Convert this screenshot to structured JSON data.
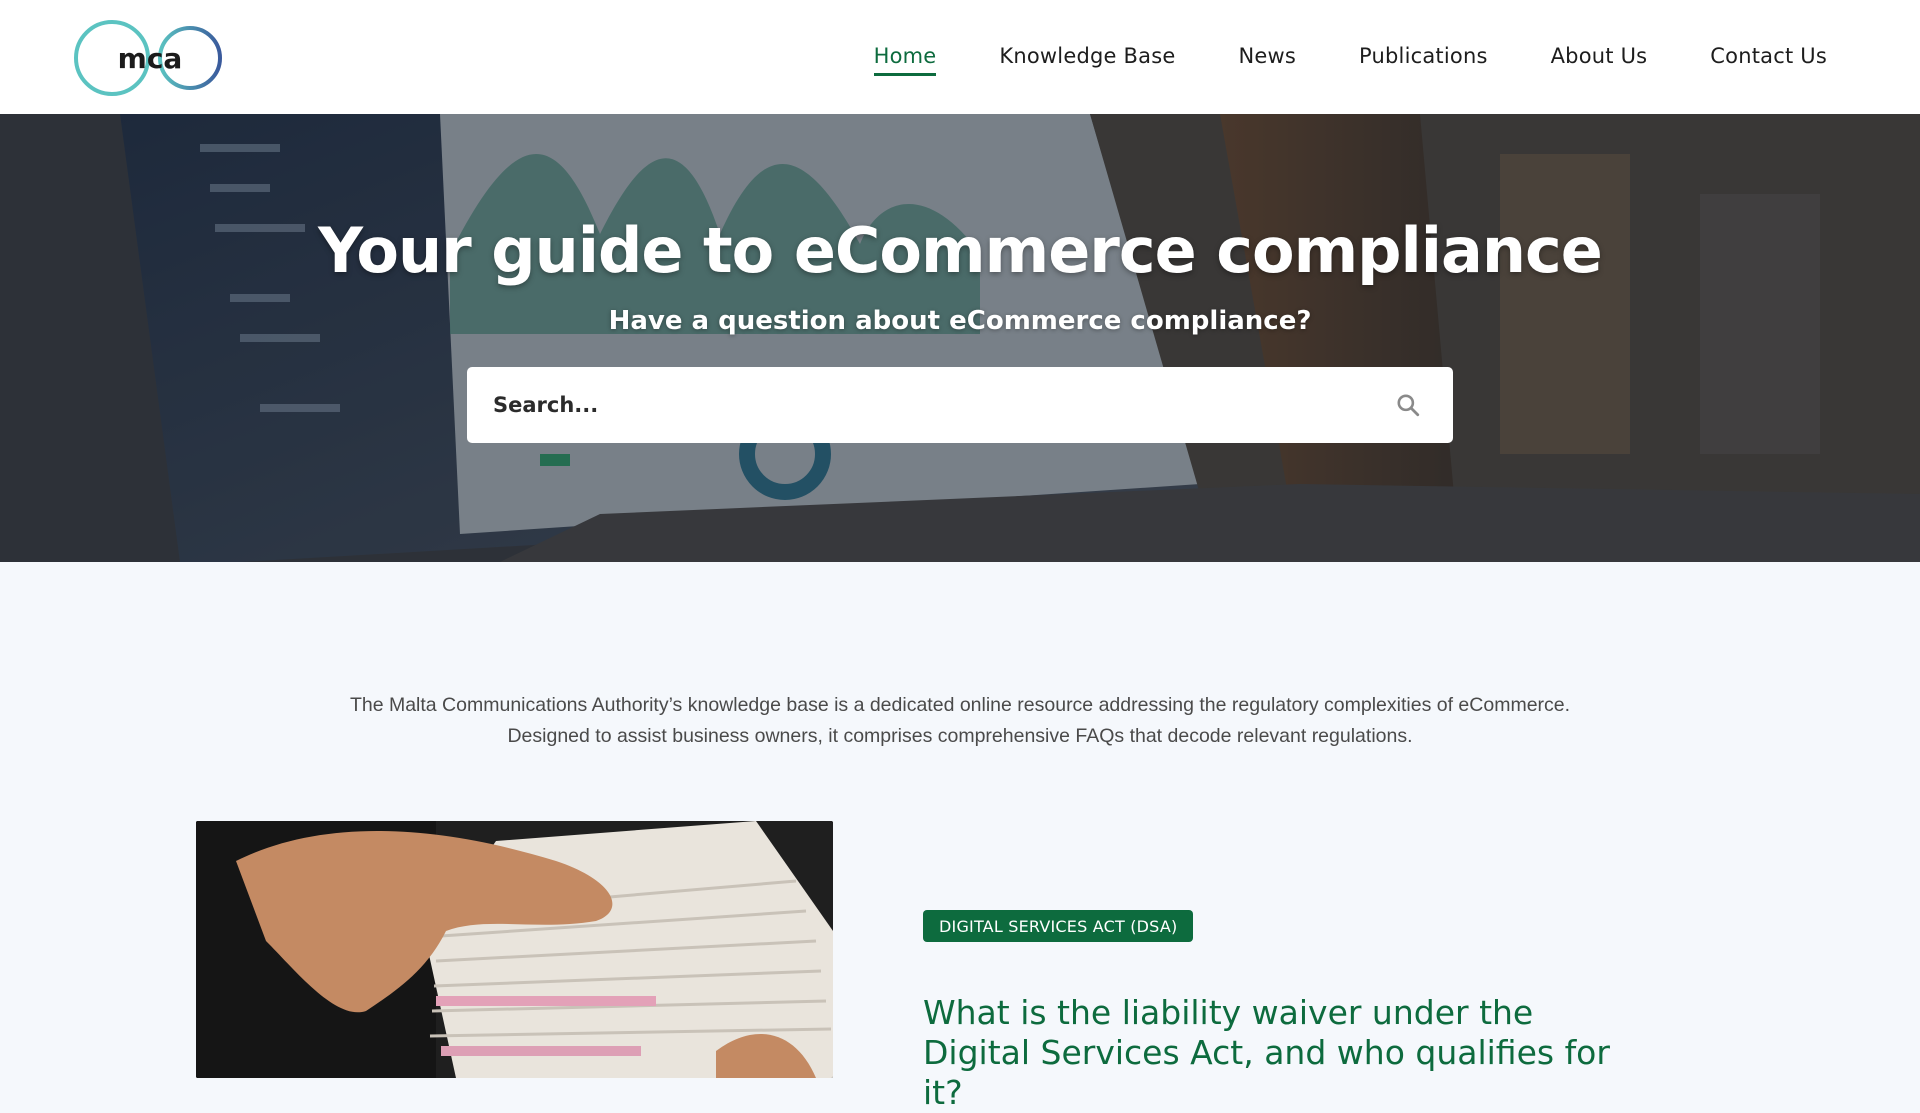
{
  "header": {
    "logo_text": "mca",
    "nav": [
      {
        "label": "Home",
        "active": true
      },
      {
        "label": "Knowledge Base",
        "active": false
      },
      {
        "label": "News",
        "active": false
      },
      {
        "label": "Publications",
        "active": false
      },
      {
        "label": "About Us",
        "active": false
      },
      {
        "label": "Contact Us",
        "active": false
      }
    ]
  },
  "hero": {
    "title": "Your guide to eCommerce compliance",
    "subtitle": "Have a question about eCommerce compliance?",
    "search": {
      "placeholder": "Search...",
      "icon": "search-icon"
    }
  },
  "intro": {
    "line1": "The Malta Communications Authority’s knowledge base is a dedicated online resource addressing the regulatory complexities of eCommerce.",
    "line2": "Designed to assist business owners, it comprises comprehensive FAQs that decode relevant regulations."
  },
  "article": {
    "tag": "DIGITAL SERVICES ACT (DSA)",
    "title": "What is the liability waiver under the Digital Services Act, and who qualifies for it?"
  },
  "colors": {
    "brand_green": "#0d6b3e",
    "logo_teal": "#5bc3c1",
    "logo_blue": "#3a5a9c",
    "page_bg": "#f5f8fc"
  }
}
